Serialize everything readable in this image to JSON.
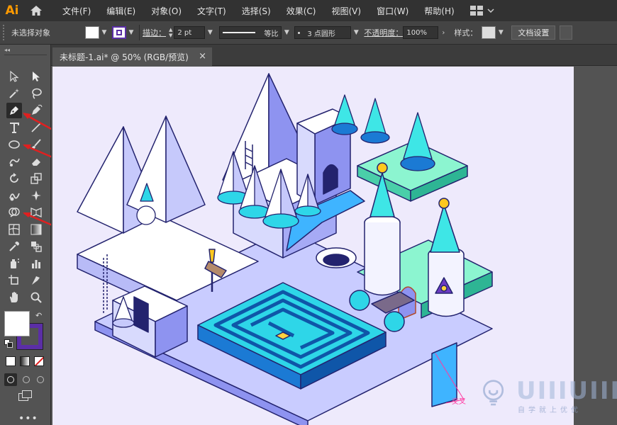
{
  "app": {
    "logo": "Ai"
  },
  "menu": [
    "文件(F)",
    "编辑(E)",
    "对象(O)",
    "文字(T)",
    "选择(S)",
    "效果(C)",
    "视图(V)",
    "窗口(W)",
    "帮助(H)"
  ],
  "control": {
    "selection_status": "未选择对象",
    "stroke_label": "描边：",
    "stroke_weight": "2 pt",
    "stroke_style": "等比",
    "brush": "3 点圆形",
    "opacity_label": "不透明度：",
    "opacity_value": "100%",
    "style_label": "样式：",
    "doc_settings": "文档设置"
  },
  "document": {
    "tab_title": "未标题-1.ai* @ 50% (RGB/预览)",
    "close": "×"
  },
  "canvas": {
    "annotation": "交叉"
  },
  "watermark": {
    "brand": "UIIIUIII",
    "tagline": "自学就上优优"
  },
  "colors": {
    "menubar": "#323232",
    "panel": "#535353",
    "artboard_bg": "#eeeafc",
    "accent_red": "#e02020",
    "fill_color": "#ffffff",
    "stroke_color": "#5b2ea6"
  }
}
